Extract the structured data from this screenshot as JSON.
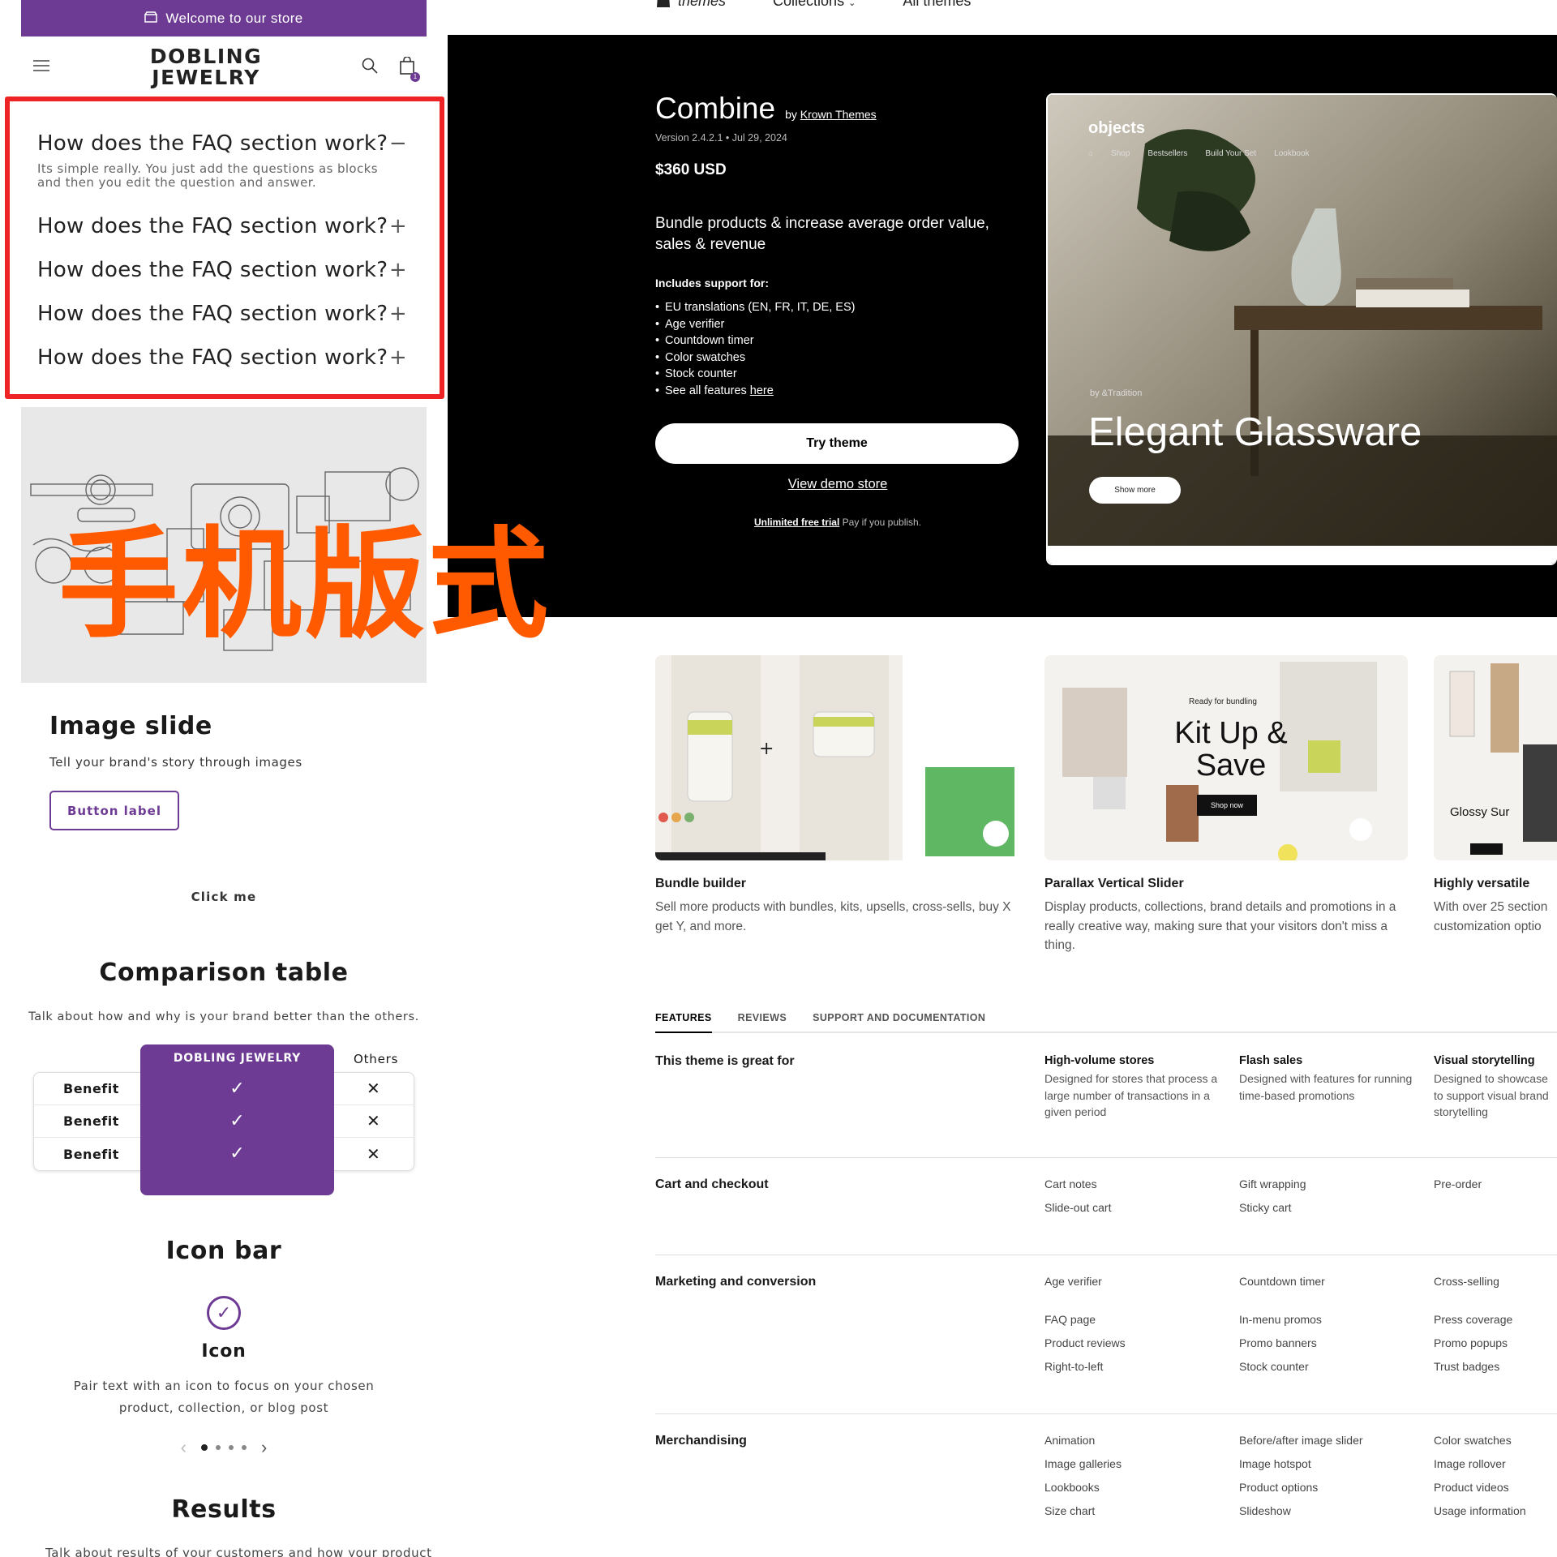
{
  "mobile": {
    "announcement": "Welcome to our store",
    "logo_line1": "DOBLING",
    "logo_line2": "JEWELRY",
    "cart_count": "1",
    "faq": {
      "open_question": "How does the FAQ section work?",
      "open_answer": "Its simple really. You just add the questions as blocks and then you edit the question and answer.",
      "items": [
        "How does the FAQ section work?",
        "How does the FAQ section work?",
        "How does the FAQ section work?",
        "How does the FAQ section work?"
      ]
    },
    "overlay_label": "手机版式",
    "image_slide": {
      "title": "Image slide",
      "text": "Tell your brand's story through images",
      "button": "Button label"
    },
    "click_me": "Click me",
    "comparison": {
      "title": "Comparison table",
      "subtitle": "Talk about how and why is your brand better than the others.",
      "brand_col": "DOBLING JEWELRY",
      "others_col": "Others",
      "rows": [
        "Benefit",
        "Benefit",
        "Benefit"
      ]
    },
    "icon_bar": {
      "title": "Icon bar",
      "icon_label": "Icon",
      "text": "Pair text with an icon to focus on your chosen product, collection, or blog post"
    },
    "results": {
      "title": "Results",
      "text": "Talk about results of your customers and how your product"
    },
    "accent": "#6d3b94"
  },
  "store": {
    "nav": {
      "brand": "themes",
      "collections": "Collections",
      "all_themes": "All themes"
    },
    "theme": {
      "name": "Combine",
      "by_prefix": "by",
      "author": "Krown Themes",
      "version": "Version 2.4.2.1",
      "date": "Jul 29, 2024",
      "price": "$360 USD",
      "tagline": "Bundle products & increase average order value, sales & revenue",
      "includes_label": "Includes support for:",
      "features": [
        "EU translations (EN, FR, IT, DE, ES)",
        "Age verifier",
        "Countdown timer",
        "Color swatches",
        "Stock counter"
      ],
      "features_more_prefix": "See all features",
      "features_more_link": "here",
      "try_button": "Try theme",
      "demo_link": "View demo store",
      "trial_link": "Unlimited free trial",
      "trial_text": "Pay if you publish."
    },
    "preview": {
      "logo": "objects",
      "links": [
        "Shop",
        "Bestsellers",
        "Build Your Set",
        "Lookbook"
      ],
      "by_line": "by &Tradition",
      "headline": "Elegant Glassware",
      "button": "Show more"
    },
    "cards": [
      {
        "title": "Bundle builder",
        "desc": "Sell more products with bundles, kits, upsells, cross-sells, buy X get Y, and more."
      },
      {
        "title": "Parallax Vertical Slider",
        "desc": "Display products, collections, brand details and promotions in a really creative way, making sure that your visitors don't miss a thing.",
        "thumb_text1": "Ready for bundling",
        "thumb_text2": "Kit Up &",
        "thumb_text3": "Save",
        "thumb_btn": "Shop now"
      },
      {
        "title": "Highly versatile",
        "desc": "With over 25 section customization optio",
        "thumb_text": "Glossy Sur"
      }
    ],
    "tabs": [
      "FEATURES",
      "REVIEWS",
      "SUPPORT AND DOCUMENTATION"
    ],
    "sections": [
      {
        "title": "This theme is great for",
        "groups": [
          {
            "title": "High-volume stores",
            "desc": "Designed for stores that process a large number of transactions in a given period"
          },
          {
            "title": "Flash sales",
            "desc": "Designed with features for running time-based promotions"
          },
          {
            "title": "Visual storytelling",
            "desc": "Designed to showcase to support visual brand storytelling"
          }
        ]
      },
      {
        "title": "Cart and checkout",
        "cols": [
          [
            "Cart notes",
            "Slide-out cart"
          ],
          [
            "Gift wrapping",
            "Sticky cart"
          ],
          [
            "Pre-order"
          ]
        ]
      },
      {
        "title": "Marketing and conversion",
        "cols": [
          [
            "Age verifier",
            "",
            "FAQ page",
            "Product reviews",
            "Right-to-left"
          ],
          [
            "Countdown timer",
            "",
            "In-menu promos",
            "Promo banners",
            "Stock counter"
          ],
          [
            "Cross-selling",
            "",
            "Press coverage",
            "Promo popups",
            "Trust badges"
          ]
        ]
      },
      {
        "title": "Merchandising",
        "cols": [
          [
            "Animation",
            "Image galleries",
            "Lookbooks",
            "Size chart"
          ],
          [
            "Before/after image slider",
            "Image hotspot",
            "Product options",
            "Slideshow"
          ],
          [
            "Color swatches",
            "Image rollover",
            "Product videos",
            "Usage information"
          ]
        ]
      }
    ]
  }
}
